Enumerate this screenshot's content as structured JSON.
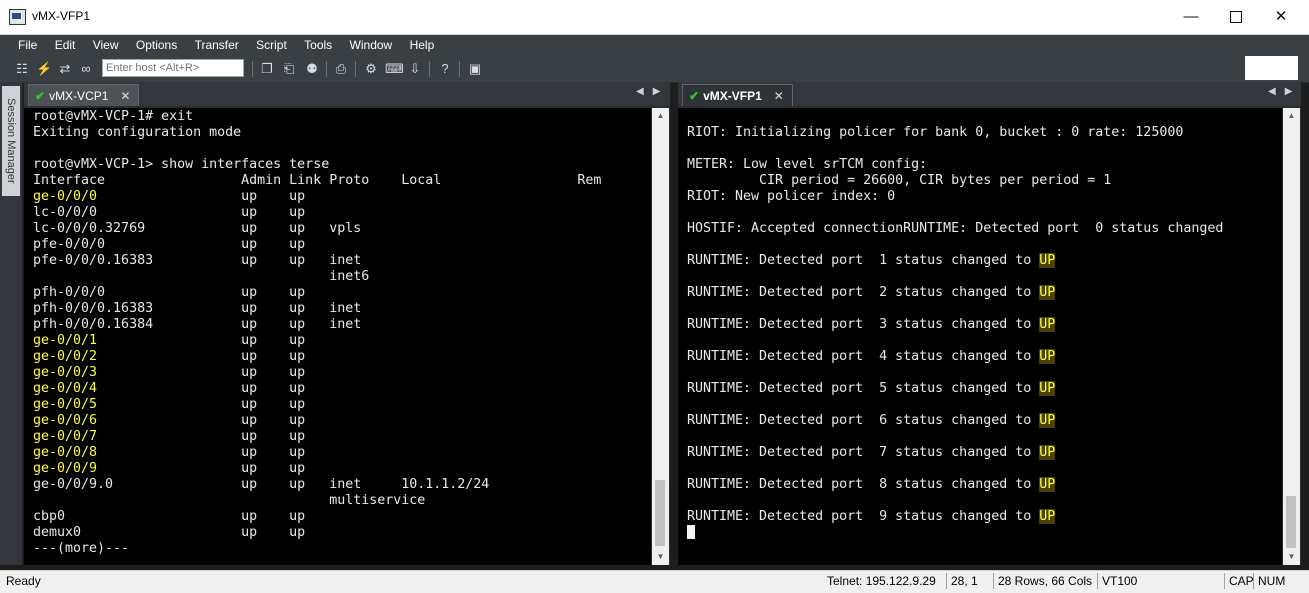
{
  "window": {
    "title": "vMX-VFP1"
  },
  "menu": [
    "File",
    "Edit",
    "View",
    "Options",
    "Transfer",
    "Script",
    "Tools",
    "Window",
    "Help"
  ],
  "toolbar": {
    "host_placeholder": "Enter host <Alt+R>"
  },
  "session_manager_label": "Session Manager",
  "left_pane": {
    "tab_label": "vMX-VCP1",
    "lines": [
      [
        {
          "t": "root@vMX-VCP-1# exit"
        }
      ],
      [
        {
          "t": "Exiting configuration mode"
        }
      ],
      [
        {
          "t": ""
        }
      ],
      [
        {
          "t": "root@vMX-VCP-1> show interfaces terse"
        }
      ],
      [
        {
          "t": "Interface                 Admin Link Proto    Local                 Rem"
        }
      ],
      [
        {
          "t": "ge-0/0/0",
          "c": "y"
        },
        {
          "t": "                  up    up"
        }
      ],
      [
        {
          "t": "lc-0/0/0                  up    up"
        }
      ],
      [
        {
          "t": "lc-0/0/0.32769            up    up   vpls"
        }
      ],
      [
        {
          "t": "pfe-0/0/0                 up    up"
        }
      ],
      [
        {
          "t": "pfe-0/0/0.16383           up    up   inet"
        }
      ],
      [
        {
          "t": "                                     inet6"
        }
      ],
      [
        {
          "t": "pfh-0/0/0                 up    up"
        }
      ],
      [
        {
          "t": "pfh-0/0/0.16383           up    up   inet"
        }
      ],
      [
        {
          "t": "pfh-0/0/0.16384           up    up   inet"
        }
      ],
      [
        {
          "t": "ge-0/0/1",
          "c": "y"
        },
        {
          "t": "                  up    up"
        }
      ],
      [
        {
          "t": "ge-0/0/2",
          "c": "y"
        },
        {
          "t": "                  up    up"
        }
      ],
      [
        {
          "t": "ge-0/0/3",
          "c": "y"
        },
        {
          "t": "                  up    up"
        }
      ],
      [
        {
          "t": "ge-0/0/4",
          "c": "y"
        },
        {
          "t": "                  up    up"
        }
      ],
      [
        {
          "t": "ge-0/0/5",
          "c": "y"
        },
        {
          "t": "                  up    up"
        }
      ],
      [
        {
          "t": "ge-0/0/6",
          "c": "y"
        },
        {
          "t": "                  up    up"
        }
      ],
      [
        {
          "t": "ge-0/0/7",
          "c": "y"
        },
        {
          "t": "                  up    up"
        }
      ],
      [
        {
          "t": "ge-0/0/8",
          "c": "y"
        },
        {
          "t": "                  up    up"
        }
      ],
      [
        {
          "t": "ge-0/0/9",
          "c": "y"
        },
        {
          "t": "                  up    up"
        }
      ],
      [
        {
          "t": "ge-0/0/9.0                up    up   inet     10.1.1.2/24"
        }
      ],
      [
        {
          "t": "                                     multiservice"
        }
      ],
      [
        {
          "t": "cbp0                      up    up"
        }
      ],
      [
        {
          "t": "demux0                    up    up"
        }
      ],
      [
        {
          "t": "---(more)---"
        }
      ]
    ]
  },
  "right_pane": {
    "tab_label": "vMX-VFP1",
    "lines": [
      [
        {
          "t": ""
        }
      ],
      [
        {
          "t": "RIOT: Initializing policer for bank 0, bucket : 0 rate: 125000"
        }
      ],
      [
        {
          "t": ""
        }
      ],
      [
        {
          "t": "METER: Low level srTCM config:"
        }
      ],
      [
        {
          "t": "         CIR period = 26600, CIR bytes per period = 1"
        }
      ],
      [
        {
          "t": "RIOT: New policer index: 0"
        }
      ],
      [
        {
          "t": ""
        }
      ],
      [
        {
          "t": "HOSTIF: Accepted connectionRUNTIME: Detected port  0 status changed"
        }
      ],
      [
        {
          "t": ""
        }
      ],
      [
        {
          "t": "RUNTIME: Detected port  1 status changed to "
        },
        {
          "t": "UP",
          "c": "uphl"
        }
      ],
      [
        {
          "t": ""
        }
      ],
      [
        {
          "t": "RUNTIME: Detected port  2 status changed to "
        },
        {
          "t": "UP",
          "c": "uphl"
        }
      ],
      [
        {
          "t": ""
        }
      ],
      [
        {
          "t": "RUNTIME: Detected port  3 status changed to "
        },
        {
          "t": "UP",
          "c": "uphl"
        }
      ],
      [
        {
          "t": ""
        }
      ],
      [
        {
          "t": "RUNTIME: Detected port  4 status changed to "
        },
        {
          "t": "UP",
          "c": "uphl"
        }
      ],
      [
        {
          "t": ""
        }
      ],
      [
        {
          "t": "RUNTIME: Detected port  5 status changed to "
        },
        {
          "t": "UP",
          "c": "uphl"
        }
      ],
      [
        {
          "t": ""
        }
      ],
      [
        {
          "t": "RUNTIME: Detected port  6 status changed to "
        },
        {
          "t": "UP",
          "c": "uphl"
        }
      ],
      [
        {
          "t": ""
        }
      ],
      [
        {
          "t": "RUNTIME: Detected port  7 status changed to "
        },
        {
          "t": "UP",
          "c": "uphl"
        }
      ],
      [
        {
          "t": ""
        }
      ],
      [
        {
          "t": "RUNTIME: Detected port  8 status changed to "
        },
        {
          "t": "UP",
          "c": "uphl"
        }
      ],
      [
        {
          "t": ""
        }
      ],
      [
        {
          "t": "RUNTIME: Detected port  9 status changed to "
        },
        {
          "t": "UP",
          "c": "uphl"
        }
      ],
      [
        {
          "t": ""
        }
      ]
    ]
  },
  "status": {
    "ready": "Ready",
    "connection": "Telnet: 195.122.9.29",
    "cursor": "28,   1",
    "size": "28 Rows, 66 Cols",
    "emulation": "VT100",
    "caps": "CAP",
    "num": "NUM"
  },
  "colors": {
    "highlight_yellow": "#ffff3c",
    "check_green": "#24d024"
  }
}
